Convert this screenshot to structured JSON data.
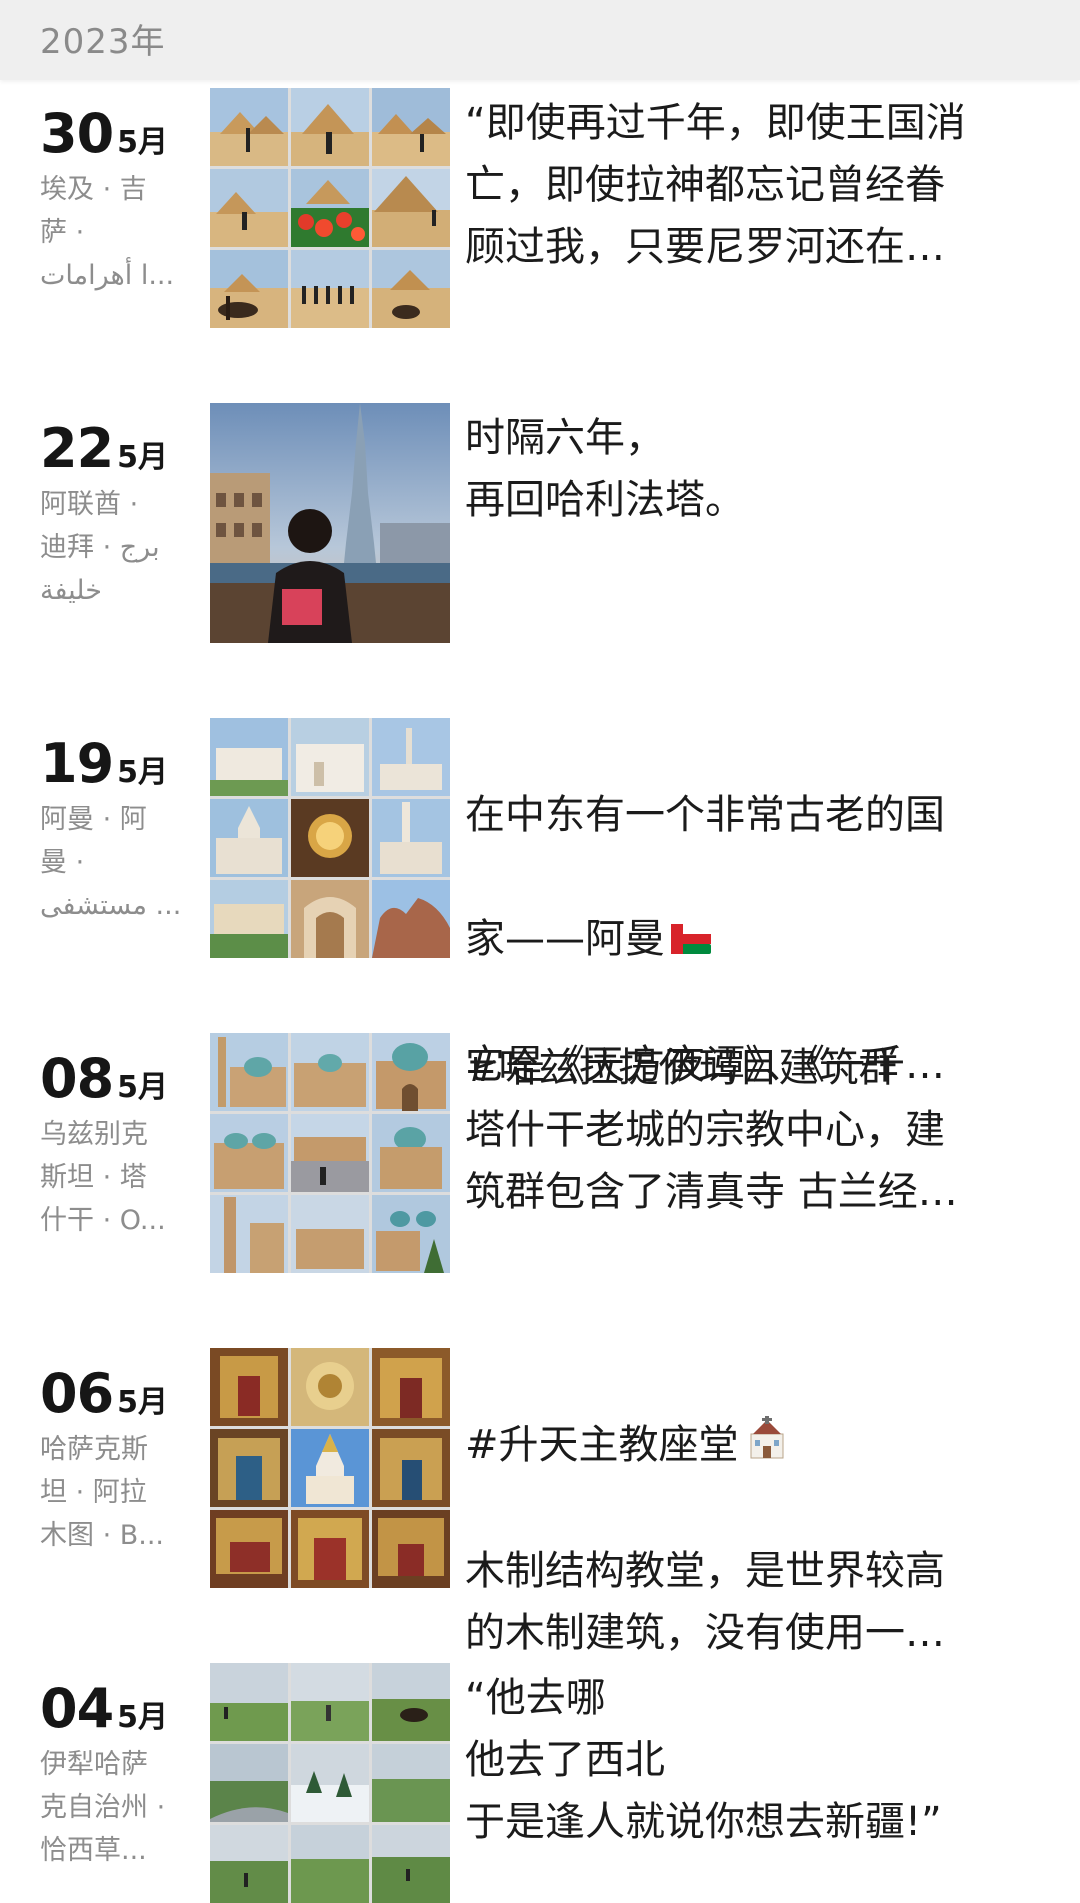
{
  "header": {
    "year": "2023年"
  },
  "posts": [
    {
      "day": "30",
      "month": "5月",
      "location": "埃及 · 吉\n萨 ·\nا أهرامات...",
      "caption": "“即使再过千年，即使王国消\n亡，即使拉神都忘记曾经眷\n顾过我，只要尼罗河还在…",
      "thumb": "pyramids-collage"
    },
    {
      "day": "22",
      "month": "5月",
      "location": "阿联酋 ·\n迪拜 · برج\nخليفة",
      "caption": "时隔六年，\n再回哈利法塔。",
      "thumb": "burj-khalifa-photo"
    },
    {
      "day": "19",
      "month": "5月",
      "location": "阿曼 · 阿\n曼 ·\nمستشفى ...",
      "caption_line1": "在中东有一个非常古老的国",
      "caption_line2": "家——阿曼",
      "caption_line3": "它是《天方夜谭》、《一千…",
      "flag_icon": "oman-flag-icon",
      "thumb": "oman-mosque-collage"
    },
    {
      "day": "08",
      "month": "5月",
      "location": "乌兹别克\n斯坦 · 塔\n什干 · O...",
      "caption": "#哈兹拉提伊玛目建筑群\n塔什干老城的宗教中心，建\n筑群包含了清真寺 古兰经…",
      "thumb": "tashkent-complex-collage"
    },
    {
      "day": "06",
      "month": "5月",
      "location": "哈萨克斯\n坦 · 阿拉\n木图 · B...",
      "caption_line1": "#升天主教座堂",
      "caption_line2": "木制结构教堂，是世界较高\n的木制建筑，没有使用一…",
      "church_icon": "church-icon",
      "thumb": "almaty-cathedral-collage"
    },
    {
      "day": "04",
      "month": "5月",
      "location": "伊犁哈萨\n克自治州 ·\n恰西草...",
      "caption": "“他去哪\n他去了西北\n于是逢人就说你想去新疆!”",
      "thumb": "xinjiang-grassland-collage"
    }
  ],
  "colors": {
    "header_bg": "#efefef",
    "year_text": "#8a8a8a",
    "location_text": "#8d8d8d",
    "caption_text": "#1b1b1b"
  }
}
